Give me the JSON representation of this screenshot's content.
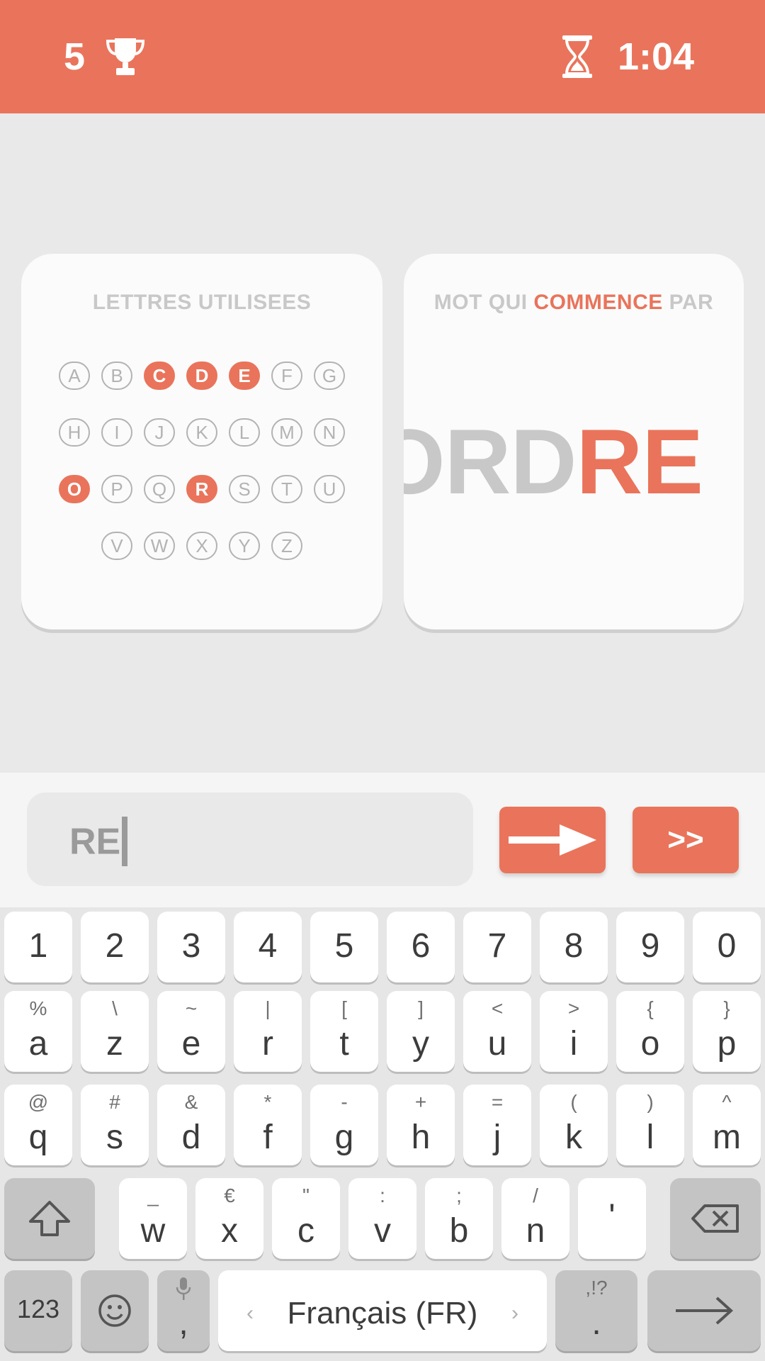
{
  "header": {
    "score": "5",
    "timer": "1:04"
  },
  "used_letters_card": {
    "title": "LETTRES UTILISEES",
    "rows": [
      [
        {
          "l": "A",
          "used": false
        },
        {
          "l": "B",
          "used": false
        },
        {
          "l": "C",
          "used": true
        },
        {
          "l": "D",
          "used": true
        },
        {
          "l": "E",
          "used": true
        },
        {
          "l": "F",
          "used": false
        },
        {
          "l": "G",
          "used": false
        }
      ],
      [
        {
          "l": "H",
          "used": false
        },
        {
          "l": "I",
          "used": false
        },
        {
          "l": "J",
          "used": false
        },
        {
          "l": "K",
          "used": false
        },
        {
          "l": "L",
          "used": false
        },
        {
          "l": "M",
          "used": false
        },
        {
          "l": "N",
          "used": false
        }
      ],
      [
        {
          "l": "O",
          "used": true
        },
        {
          "l": "P",
          "used": false
        },
        {
          "l": "Q",
          "used": false
        },
        {
          "l": "R",
          "used": true
        },
        {
          "l": "S",
          "used": false
        },
        {
          "l": "T",
          "used": false
        },
        {
          "l": "U",
          "used": false
        }
      ],
      [
        {
          "l": "V",
          "used": false
        },
        {
          "l": "W",
          "used": false
        },
        {
          "l": "X",
          "used": false
        },
        {
          "l": "Y",
          "used": false
        },
        {
          "l": "Z",
          "used": false
        }
      ]
    ]
  },
  "word_card": {
    "title_prefix": "MOT QUI ",
    "title_accent": "COMMENCE",
    "title_suffix": " PAR",
    "word_stem": "ORD",
    "word_tail": "RE"
  },
  "input": {
    "value": "RE",
    "skip_label": ">>"
  },
  "keyboard": {
    "digits": [
      "1",
      "2",
      "3",
      "4",
      "5",
      "6",
      "7",
      "8",
      "9",
      "0"
    ],
    "row1": [
      {
        "k": "a",
        "s": "%"
      },
      {
        "k": "z",
        "s": "\\"
      },
      {
        "k": "e",
        "s": "~"
      },
      {
        "k": "r",
        "s": "|"
      },
      {
        "k": "t",
        "s": "["
      },
      {
        "k": "y",
        "s": "]"
      },
      {
        "k": "u",
        "s": "<"
      },
      {
        "k": "i",
        "s": ">"
      },
      {
        "k": "o",
        "s": "{"
      },
      {
        "k": "p",
        "s": "}"
      }
    ],
    "row2": [
      {
        "k": "q",
        "s": "@"
      },
      {
        "k": "s",
        "s": "#"
      },
      {
        "k": "d",
        "s": "&"
      },
      {
        "k": "f",
        "s": "*"
      },
      {
        "k": "g",
        "s": "-"
      },
      {
        "k": "h",
        "s": "+"
      },
      {
        "k": "j",
        "s": "="
      },
      {
        "k": "k",
        "s": "("
      },
      {
        "k": "l",
        "s": ")"
      },
      {
        "k": "m",
        "s": "^"
      }
    ],
    "row3": [
      {
        "k": "w",
        "s": "_"
      },
      {
        "k": "x",
        "s": "€"
      },
      {
        "k": "c",
        "s": "\""
      },
      {
        "k": "v",
        "s": ":"
      },
      {
        "k": "b",
        "s": ";"
      },
      {
        "k": "n",
        "s": "/"
      },
      {
        "k": "'",
        "s": ""
      }
    ],
    "numbers_key": "123",
    "comma_key": ",",
    "period_key": ".",
    "period_sub": ",!?",
    "space_label": "Français (FR)"
  },
  "colors": {
    "accent": "#e9745b",
    "muted": "#c8c8c8"
  }
}
